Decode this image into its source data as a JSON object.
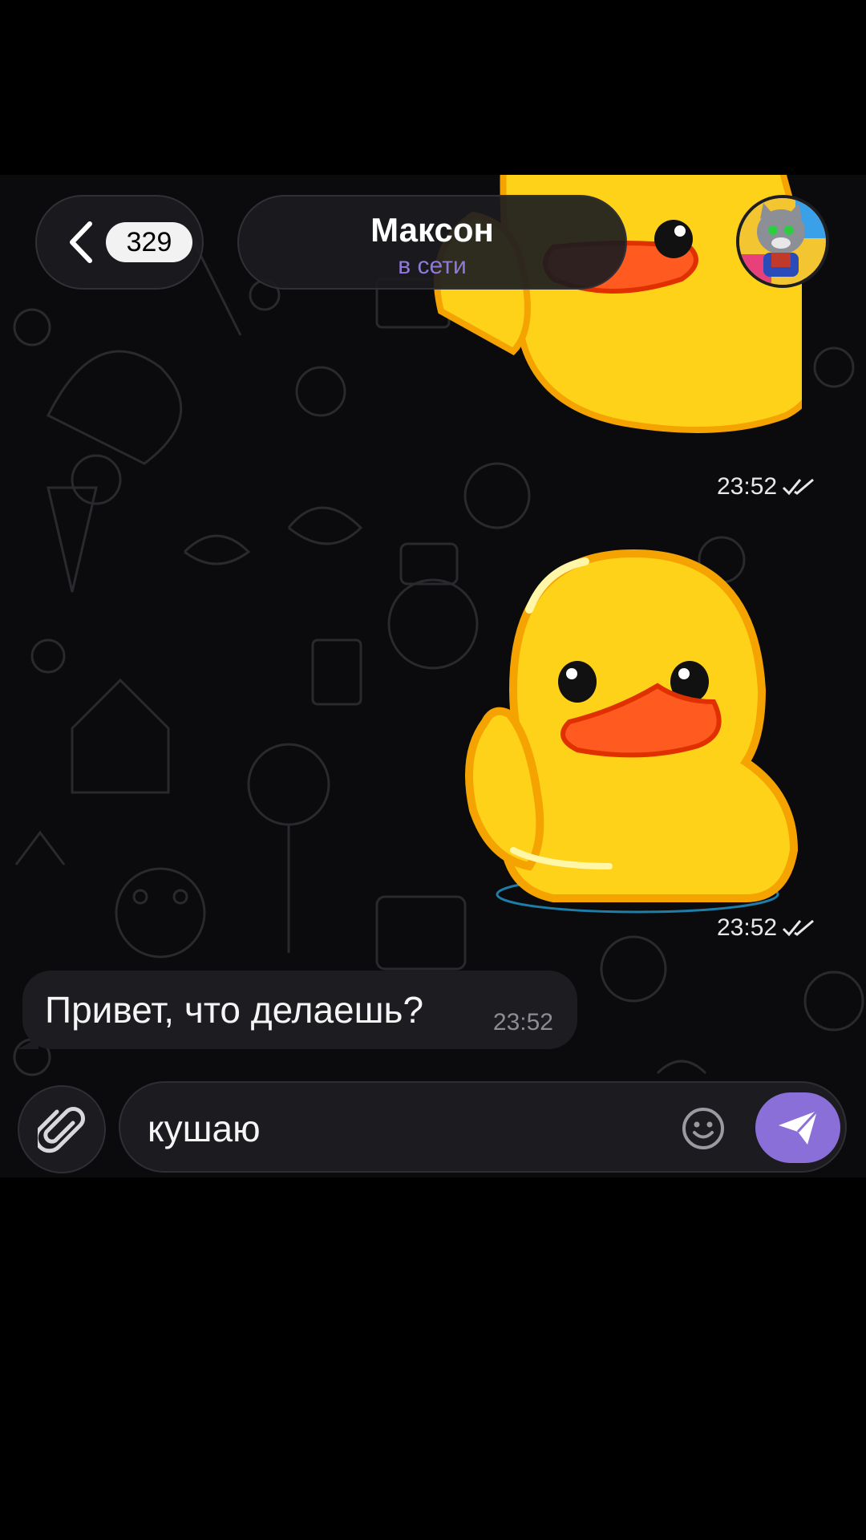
{
  "header": {
    "back_badge_count": "329",
    "contact_name": "Максон",
    "contact_status": "в сети"
  },
  "messages": [
    {
      "type": "sticker",
      "direction": "out",
      "time": "23:52",
      "status": "read"
    },
    {
      "type": "sticker",
      "direction": "out",
      "time": "23:52",
      "status": "read"
    },
    {
      "type": "text",
      "direction": "in",
      "text": "Привет, что делаешь?",
      "time": "23:52"
    }
  ],
  "composer": {
    "text": "кушаю"
  },
  "colors": {
    "accent": "#8b6fd8",
    "status_online": "#8f7ad9",
    "duck_yellow": "#ffd21a",
    "duck_beak": "#ff5a1f"
  }
}
